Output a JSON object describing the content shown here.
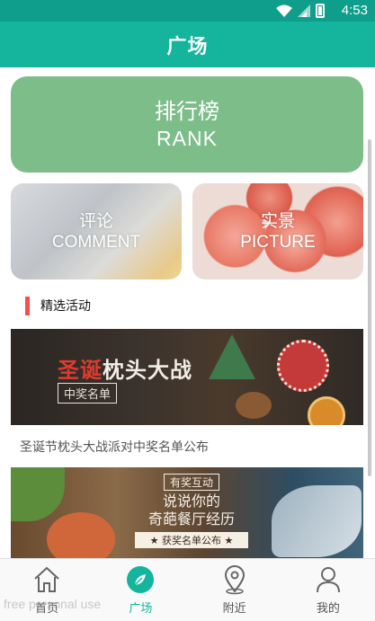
{
  "status_bar": {
    "time": "4:53"
  },
  "app_bar": {
    "title": "广场"
  },
  "rank_card": {
    "title_cn": "排行榜",
    "title_en": "RANK"
  },
  "comment_card": {
    "title_cn": "评论",
    "title_en": "COMMENT"
  },
  "picture_card": {
    "title_cn": "实景",
    "title_en": "PICTURE"
  },
  "section": {
    "label": "精选活动"
  },
  "activities": [
    {
      "banner_headline_red": "圣诞",
      "banner_headline": "枕头大战",
      "banner_sub": "中奖名单",
      "title": "圣诞节枕头大战派对中奖名单公布"
    },
    {
      "banner_tag": "有奖互动",
      "banner_line1": "说说你的",
      "banner_line2": "奇葩餐厅经历",
      "banner_line3": "★ 获奖名单公布 ★"
    }
  ],
  "bottom_nav": [
    {
      "label": "首页",
      "icon": "home-icon",
      "active": false
    },
    {
      "label": "广场",
      "icon": "compass-leaf-icon",
      "active": true
    },
    {
      "label": "附近",
      "icon": "location-pin-icon",
      "active": false
    },
    {
      "label": "我的",
      "icon": "person-icon",
      "active": false
    }
  ],
  "watermark": "free personal use",
  "colors": {
    "primary": "#14b59c",
    "status_bar": "#0f9e8b",
    "rank_card": "#7dbd8a",
    "section_accent": "#f4504c"
  }
}
